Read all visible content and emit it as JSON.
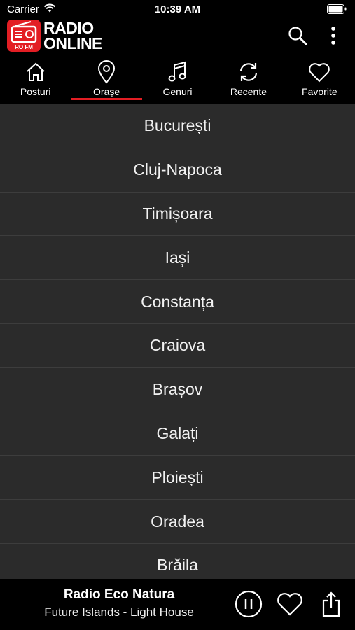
{
  "status_bar": {
    "carrier": "Carrier",
    "time": "10:39 AM"
  },
  "logo": {
    "line1": "RADIO",
    "line2": "ONLINE",
    "badge": "RO FM"
  },
  "tabs": [
    {
      "label": "Posturi",
      "icon": "home-icon"
    },
    {
      "label": "Orașe",
      "icon": "location-pin-icon",
      "active": true
    },
    {
      "label": "Genuri",
      "icon": "music-note-icon"
    },
    {
      "label": "Recente",
      "icon": "refresh-icon"
    },
    {
      "label": "Favorite",
      "icon": "heart-icon"
    }
  ],
  "cities": [
    "București",
    "Cluj-Napoca",
    "Timișoara",
    "Iași",
    "Constanța",
    "Craiova",
    "Brașov",
    "Galați",
    "Ploiești",
    "Oradea",
    "Brăila"
  ],
  "player": {
    "title": "Radio Eco Natura",
    "subtitle": "Future Islands - Light House"
  },
  "colors": {
    "accent": "#e31e24",
    "background": "#000000",
    "row": "#2b2b2b"
  }
}
